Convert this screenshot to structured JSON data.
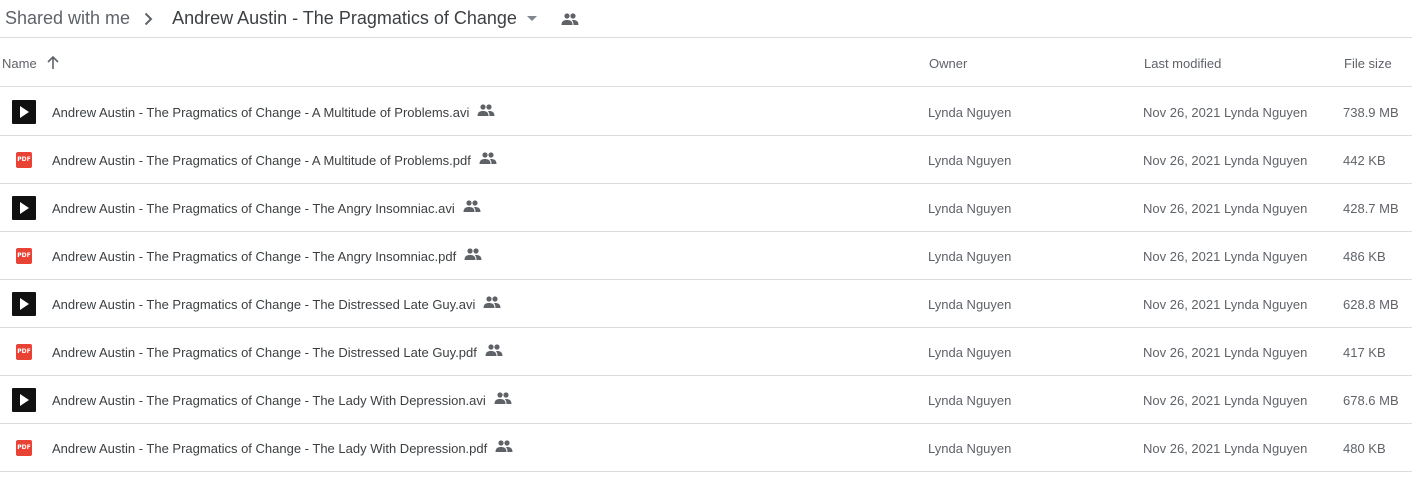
{
  "breadcrumb": {
    "root": "Shared with me",
    "current": "Andrew Austin - The Pragmatics of Change",
    "separator_icon": "chevron-right-icon",
    "dropdown_icon": "caret-down-icon",
    "shared_icon": "people-icon"
  },
  "columns": {
    "name": "Name",
    "owner": "Owner",
    "last_modified": "Last modified",
    "file_size": "File size",
    "sort_icon": "arrow-up-icon"
  },
  "files": [
    {
      "type": "video",
      "name": "Andrew Austin - The Pragmatics of Change - A Multitude of Problems.avi",
      "owner": "Lynda Nguyen",
      "modified_date": "Nov 26, 2021",
      "modified_by": "Lynda Nguyen",
      "size": "738.9 MB"
    },
    {
      "type": "pdf",
      "name": "Andrew Austin - The Pragmatics of Change - A Multitude of Problems.pdf",
      "owner": "Lynda Nguyen",
      "modified_date": "Nov 26, 2021",
      "modified_by": "Lynda Nguyen",
      "size": "442 KB"
    },
    {
      "type": "video",
      "name": "Andrew Austin - The Pragmatics of Change - The Angry Insomniac.avi",
      "owner": "Lynda Nguyen",
      "modified_date": "Nov 26, 2021",
      "modified_by": "Lynda Nguyen",
      "size": "428.7 MB"
    },
    {
      "type": "pdf",
      "name": "Andrew Austin - The Pragmatics of Change - The Angry Insomniac.pdf",
      "owner": "Lynda Nguyen",
      "modified_date": "Nov 26, 2021",
      "modified_by": "Lynda Nguyen",
      "size": "486 KB"
    },
    {
      "type": "video",
      "name": "Andrew Austin - The Pragmatics of Change - The Distressed Late Guy.avi",
      "owner": "Lynda Nguyen",
      "modified_date": "Nov 26, 2021",
      "modified_by": "Lynda Nguyen",
      "size": "628.8 MB"
    },
    {
      "type": "pdf",
      "name": "Andrew Austin - The Pragmatics of Change - The Distressed Late Guy.pdf",
      "owner": "Lynda Nguyen",
      "modified_date": "Nov 26, 2021",
      "modified_by": "Lynda Nguyen",
      "size": "417 KB"
    },
    {
      "type": "video",
      "name": "Andrew Austin - The Pragmatics of Change - The Lady With Depression.avi",
      "owner": "Lynda Nguyen",
      "modified_date": "Nov 26, 2021",
      "modified_by": "Lynda Nguyen",
      "size": "678.6 MB"
    },
    {
      "type": "pdf",
      "name": "Andrew Austin - The Pragmatics of Change - The Lady With Depression.pdf",
      "owner": "Lynda Nguyen",
      "modified_date": "Nov 26, 2021",
      "modified_by": "Lynda Nguyen",
      "size": "480 KB"
    }
  ],
  "pdf_badge_text": "PDF",
  "colors": {
    "pdf_red": "#ea4335",
    "divider": "#dadce0",
    "text_secondary": "#5f6368",
    "text_primary": "#3c4043"
  }
}
